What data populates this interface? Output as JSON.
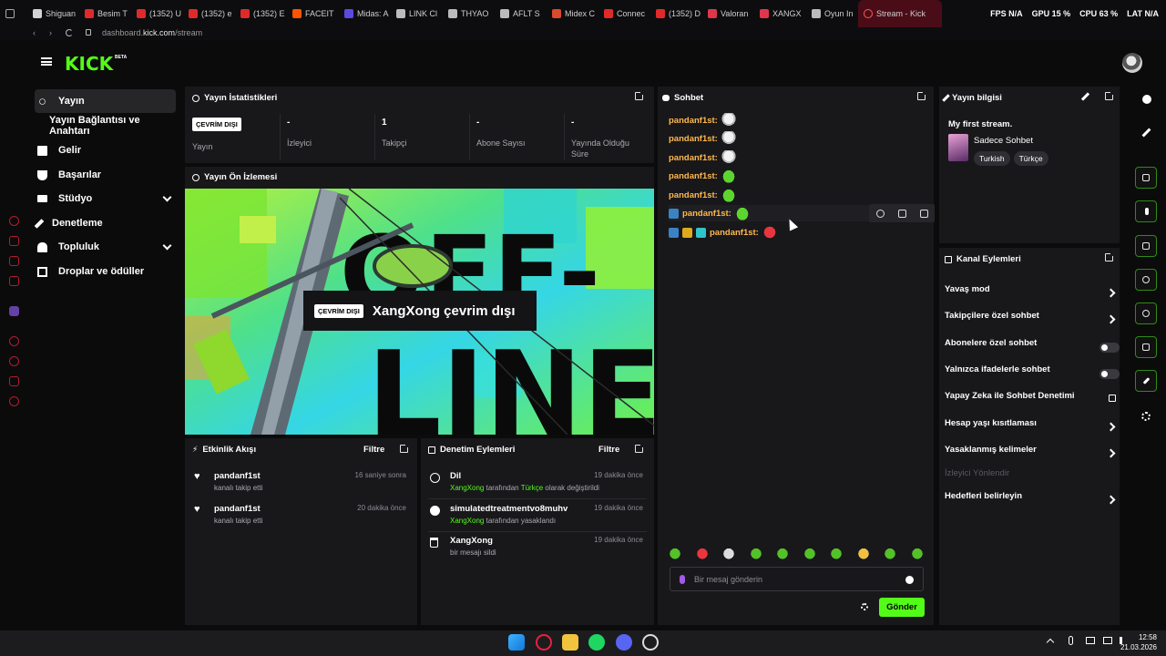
{
  "browser": {
    "tabs": [
      {
        "label": "Shiguan",
        "color": "#d3d3d3"
      },
      {
        "label": "Besim T",
        "color": "#e02a2a"
      },
      {
        "label": "(1352) U",
        "color": "#e02a2a"
      },
      {
        "label": "(1352) e",
        "color": "#e02a2a"
      },
      {
        "label": "(1352) E",
        "color": "#e02a2a"
      },
      {
        "label": "FACEIT",
        "color": "#ff5500"
      },
      {
        "label": "Midas: A",
        "color": "#5a4be0"
      },
      {
        "label": "LINK Cl",
        "color": "#bbbbbb"
      },
      {
        "label": "THYAO",
        "color": "#bbbbbb"
      },
      {
        "label": "AFLT S",
        "color": "#bbbbbb"
      },
      {
        "label": "Midex C",
        "color": "#d94b2b"
      },
      {
        "label": "Connec",
        "color": "#e02a2a"
      },
      {
        "label": "(1352) D",
        "color": "#e02a2a"
      },
      {
        "label": "Valoran",
        "color": "#e0364b"
      },
      {
        "label": "XANGX",
        "color": "#e0364b"
      },
      {
        "label": "Oyun In",
        "color": "#bbbbbb"
      }
    ],
    "active_tab": "Stream - Kick",
    "stats": {
      "fps": "FPS N/A",
      "gpu": "GPU 15 %",
      "cpu": "CPU 63 %",
      "lat": "LAT N/A"
    },
    "url_prefix": "dashboard.",
    "url_domain": "kick.com",
    "url_path": "/stream"
  },
  "kick": {
    "logo": "KICK",
    "logo_beta": "BETA"
  },
  "nav": {
    "items": [
      {
        "label": "Yayın",
        "icon": "broadcast-icon"
      },
      {
        "label": "Yayın Bağlantısı ve Anahtarı",
        "icon": ""
      },
      {
        "label": "Gelir",
        "icon": "chart-icon"
      },
      {
        "label": "Başarılar",
        "icon": "trophy-icon"
      },
      {
        "label": "Stüdyo",
        "icon": "studio-icon"
      },
      {
        "label": "Denetleme",
        "icon": "wrench-icon"
      },
      {
        "label": "Topluluk",
        "icon": "people-icon"
      },
      {
        "label": "Droplar ve ödüller",
        "icon": "gift-icon"
      }
    ]
  },
  "stats_panel": {
    "title": "Yayın İstatistikleri",
    "status_badge": "ÇEVRİM DIŞI",
    "items": [
      {
        "value": "",
        "label": "Yayın"
      },
      {
        "value": "-",
        "label": "İzleyici"
      },
      {
        "value": "1",
        "label": "Takipçi"
      },
      {
        "value": "-",
        "label": "Abone Sayısı"
      },
      {
        "value": "-",
        "label": "Yayında Olduğu Süre"
      }
    ]
  },
  "preview": {
    "title": "Yayın Ön İzlemesi",
    "badge": "ÇEVRİM DIŞI",
    "message": "XangXong çevrim dışı",
    "art_text_top": "OFF-",
    "art_text_bottom": "LINE"
  },
  "activity": {
    "title": "Etkinlik Akışı",
    "filter": "Filtre",
    "items": [
      {
        "name": "pandanf1st",
        "sub": "kanalı takip etti",
        "time": "16 saniye sonra"
      },
      {
        "name": "pandanf1st",
        "sub": "kanalı takip etti",
        "time": "20 dakika önce"
      }
    ]
  },
  "moderation": {
    "title": "Denetim Eylemleri",
    "filter": "Filtre",
    "items": [
      {
        "name": "Dil",
        "actor": "XangXong",
        "mid": " tarafından ",
        "highlight": "Türkçe",
        "rest": " olarak değiştirildi",
        "time": "19 dakika önce",
        "icon": "globe-icon"
      },
      {
        "name": "simulatedtreatmentvo8muhv",
        "actor": "XangXong",
        "mid": " tarafından yasaklandı",
        "highlight": "",
        "rest": "",
        "time": "19 dakika önce",
        "icon": "ban-icon"
      },
      {
        "name": "XangXong",
        "actor": "",
        "mid": "bir mesajı sildi",
        "highlight": "",
        "rest": "",
        "time": "19 dakika önce",
        "icon": "trash-icon"
      }
    ]
  },
  "chat": {
    "title": "Sohbet",
    "messages": [
      {
        "user": "pandanf1st:",
        "emote": "ghost"
      },
      {
        "user": "pandanf1st:",
        "emote": "ghost"
      },
      {
        "user": "pandanf1st:",
        "emote": "ghost"
      },
      {
        "user": "pandanf1st:",
        "emote": "frog"
      },
      {
        "user": "pandanf1st:",
        "emote": "frog"
      },
      {
        "user": "pandanf1st:",
        "emote": "frog"
      },
      {
        "user": "pandanf1st:",
        "emote": "angry"
      }
    ],
    "input_placeholder": "Bir mesaj gönderin",
    "send_label": "Gönder"
  },
  "stream_info": {
    "title": "Yayın bilgisi",
    "stream_title": "My first stream.",
    "category": "Sadece Sohbet",
    "tags": [
      "Turkish",
      "Türkçe"
    ]
  },
  "channel_actions": {
    "title": "Kanal Eylemleri",
    "items": [
      {
        "label": "Yavaş mod",
        "control": "chevron"
      },
      {
        "label": "Takipçilere özel sohbet",
        "control": "chevron"
      },
      {
        "label": "Abonelere özel sohbet",
        "control": "toggle"
      },
      {
        "label": "Yalnızca ifadelerle sohbet",
        "control": "toggle"
      },
      {
        "label": "Yapay Zeka ile Sohbet Denetimi",
        "control": "external"
      },
      {
        "label": "Hesap yaşı kısıtlaması",
        "control": "chevron"
      },
      {
        "label": "Yasaklanmış kelimeler",
        "control": "chevron"
      },
      {
        "label": "İzleyici Yönlendir",
        "control": "disabled"
      },
      {
        "label": "Hedefleri belirleyin",
        "control": "chevron"
      }
    ]
  },
  "taskbar": {
    "time": "12:58",
    "date": "21.03.2026"
  },
  "colors": {
    "accent": "#53fc18",
    "panel": "#18181b",
    "chat_user": "#ffb84d"
  }
}
